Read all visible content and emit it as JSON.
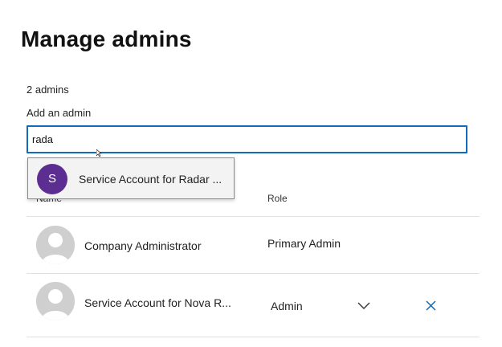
{
  "page": {
    "title": "Manage admins"
  },
  "admins": {
    "count_label": "2 admins",
    "add_label": "Add an admin",
    "search_value": "rada"
  },
  "suggestion": {
    "initial": "S",
    "label": "Service Account for Radar ...",
    "avatar_color": "#5c2e91"
  },
  "table": {
    "columns": [
      "Name",
      "Role"
    ],
    "rows": [
      {
        "name": "Company Administrator",
        "role": "Primary Admin",
        "avatar_icon": "person-icon"
      },
      {
        "name": "Service Account for Nova R...",
        "role": "Admin",
        "role_icon": "chevron-down-icon",
        "remove_icon": "close-icon",
        "avatar_icon": "person-icon"
      }
    ]
  },
  "colors": {
    "accent": "#0f6cbd",
    "divider": "#e1e1e1",
    "avatar_placeholder": "#cfcfcf"
  }
}
